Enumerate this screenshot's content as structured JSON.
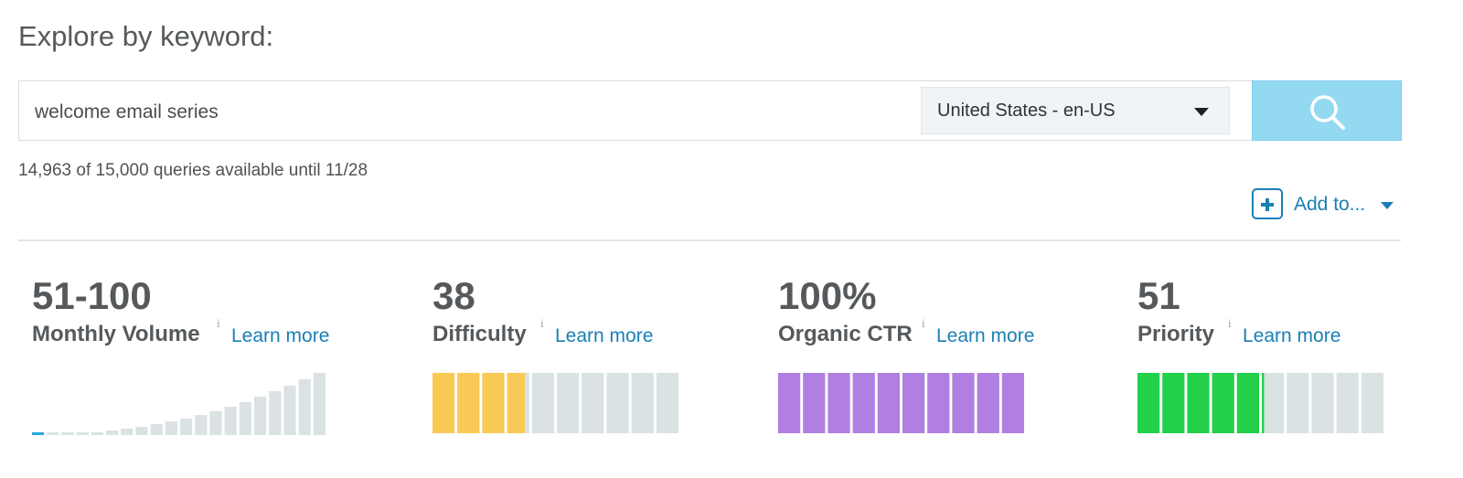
{
  "heading": "Explore by keyword:",
  "search": {
    "value": "welcome email series",
    "locale": "United States - en-US"
  },
  "quota_text": "14,963 of 15,000 queries available until 11/28",
  "add_to_label": "Add to...",
  "info_symbol": "i",
  "metrics": [
    {
      "value": "51-100",
      "label": "Monthly Volume",
      "link": "Learn more",
      "chart": "volume",
      "level": 1,
      "total": 20
    },
    {
      "value": "38",
      "label": "Difficulty",
      "link": "Learn more",
      "chart": "segments",
      "filled_fraction": 0.38,
      "segments": 10,
      "color": "#f8c955"
    },
    {
      "value": "100%",
      "label": "Organic CTR",
      "link": "Learn more",
      "chart": "segments",
      "filled_fraction": 1.0,
      "segments": 10,
      "color": "#b07fe1"
    },
    {
      "value": "51",
      "label": "Priority",
      "link": "Learn more",
      "chart": "segments",
      "filled_fraction": 0.51,
      "segments": 10,
      "color": "#22d04a"
    }
  ],
  "colors": {
    "accent": "#1a7fb5",
    "search_button": "#93d9f2",
    "empty_bar": "#dbe2e3",
    "volume_active": "#29a6de"
  },
  "icons": {
    "search_button": "search-icon",
    "locale_dropdown": "caret-down-icon",
    "add_to": "plus-box-icon"
  }
}
